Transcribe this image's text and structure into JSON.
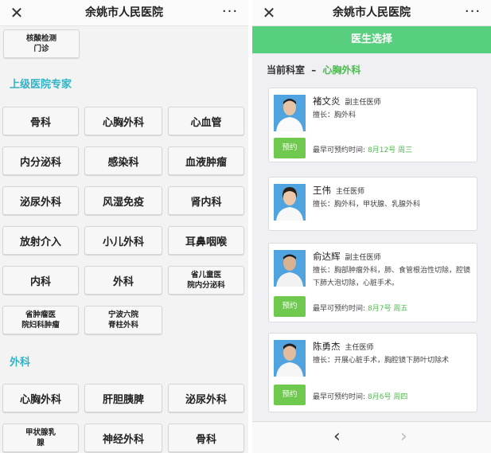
{
  "left": {
    "header": {
      "close_icon": "close-icon",
      "title": "余姚市人民医院",
      "more_label": "···"
    },
    "top_buttons": [
      "核酸检测\n门诊"
    ],
    "sections": [
      {
        "title": "上级医院专家",
        "buttons": [
          "骨科",
          "心胸外科",
          "心血管",
          "内分泌科",
          "感染科",
          "血液肿瘤",
          "泌尿外科",
          "风湿免疫",
          "肾内科",
          "放射介入",
          "小儿外科",
          "耳鼻咽喉",
          "内科",
          "外科",
          "省儿童医\n院内分泌科",
          "省肿瘤医\n院妇科肿瘤",
          "宁波六院\n脊柱外科"
        ]
      },
      {
        "title": "外科",
        "buttons": [
          "心胸外科",
          "肝胆胰脾",
          "泌尿外科",
          "甲状腺乳\n腺",
          "神经外科",
          "骨科"
        ]
      }
    ]
  },
  "right": {
    "header": {
      "close_icon": "close-icon",
      "title": "余姚市人民医院",
      "more_label": "···"
    },
    "green_title": "医生选择",
    "current_dept_label": "当前科室",
    "current_dept_sep": "–",
    "current_dept_name": "心胸外科",
    "doctors": [
      {
        "name": "褚文炎",
        "title": "副主任医师",
        "specialty": "擅长：胸外科",
        "book_label": "预约",
        "earliest_label": "最早可预约时间:",
        "earliest_date": "8月12号 周三"
      },
      {
        "name": "王伟",
        "title": "主任医师",
        "specialty": "擅长：胸外科，甲状腺、乳腺外科",
        "book_label": "",
        "earliest_label": "",
        "earliest_date": ""
      },
      {
        "name": "俞达辉",
        "title": "副主任医师",
        "specialty": "擅长：胸部肿瘤外科，肺、食管根治性切除，腔镜下肺大泡切除，心脏手术。",
        "book_label": "预约",
        "earliest_label": "最早可预约时间:",
        "earliest_date": "8月7号 周五"
      },
      {
        "name": "陈勇杰",
        "title": "主任医师",
        "specialty": "擅长：开展心脏手术，胸腔镜下肺叶切除术",
        "book_label": "预约",
        "earliest_label": "最早可预约时间:",
        "earliest_date": "8月6号 周四"
      }
    ],
    "nav": {
      "back_label": "‹",
      "forward_label": "›"
    }
  },
  "colors": {
    "accent_green": "#58cf7e",
    "section_teal": "#2fb3c6",
    "book_green": "#6fc94f"
  }
}
